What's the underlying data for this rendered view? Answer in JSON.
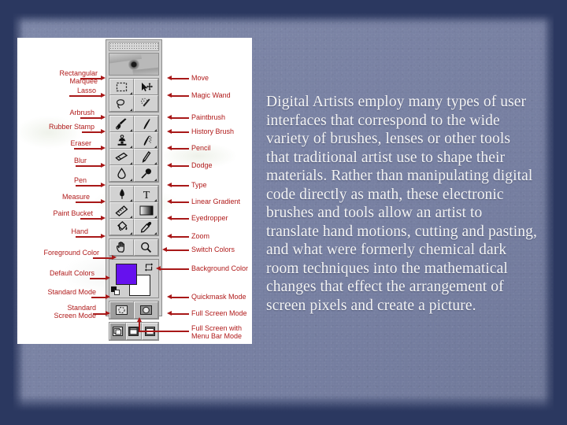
{
  "slide": {
    "background_outer_color": "#2b3860",
    "background_inner_color": "#7b84a6",
    "body_text": "Digital Artists employ many types of user interfaces that correspond to the wide variety of brushes, lenses or other tools that traditional artist use to shape their materials. Rather than manipulating digital code directly as math, these electronic brushes and tools allow an artist to translate hand motions, cutting and pasting, and what were formerly chemical dark room techniques into the mathematical changes that effect the arrangement of screen pixels and create a picture."
  },
  "diagram": {
    "panel_background": "#ffffff",
    "label_color": "#b01a1a",
    "leader_color": "#a81818",
    "toolbar": {
      "name": "photoshop-toolbox",
      "chrome_color": "#cfcfcf",
      "foreground_color": "#6611ee",
      "background_color": "#ffffff",
      "header_image": "eye-photo"
    },
    "labels_left": [
      {
        "id": "rectangular-marquee",
        "text": "Rectangular\nMarquee"
      },
      {
        "id": "lasso",
        "text": "Lasso"
      },
      {
        "id": "airbrush",
        "text": "Arbrush"
      },
      {
        "id": "rubber-stamp",
        "text": "Rubber Stamp"
      },
      {
        "id": "eraser",
        "text": "Eraser"
      },
      {
        "id": "blur",
        "text": "Blur"
      },
      {
        "id": "pen",
        "text": "Pen"
      },
      {
        "id": "measure",
        "text": "Measure"
      },
      {
        "id": "paint-bucket",
        "text": "Paint Bucket"
      },
      {
        "id": "hand",
        "text": "Hand"
      },
      {
        "id": "foreground-color",
        "text": "Foreground Color"
      },
      {
        "id": "default-colors",
        "text": "Default Colors"
      },
      {
        "id": "standard-mode",
        "text": "Standard Mode"
      },
      {
        "id": "standard-screen-mode",
        "text": "Standard\nScreen Mode"
      }
    ],
    "labels_right": [
      {
        "id": "move",
        "text": "Move"
      },
      {
        "id": "magic-wand",
        "text": "Magic Wand"
      },
      {
        "id": "paintbrush",
        "text": "Paintbrush"
      },
      {
        "id": "history-brush",
        "text": "History Brush"
      },
      {
        "id": "pencil",
        "text": "Pencil"
      },
      {
        "id": "dodge",
        "text": "Dodge"
      },
      {
        "id": "type",
        "text": "Type"
      },
      {
        "id": "linear-gradient",
        "text": "Linear Gradient"
      },
      {
        "id": "eyedropper",
        "text": "Eyedropper"
      },
      {
        "id": "zoom",
        "text": "Zoom"
      },
      {
        "id": "switch-colors",
        "text": "Switch Colors"
      },
      {
        "id": "background-color",
        "text": "Background Color"
      },
      {
        "id": "quickmask-mode",
        "text": "Quickmask Mode"
      },
      {
        "id": "full-screen-mode",
        "text": "Full Screen Mode"
      },
      {
        "id": "full-screen-menu-bar-mode",
        "text": "Full Screen with\nMenu Bar Mode"
      }
    ]
  }
}
